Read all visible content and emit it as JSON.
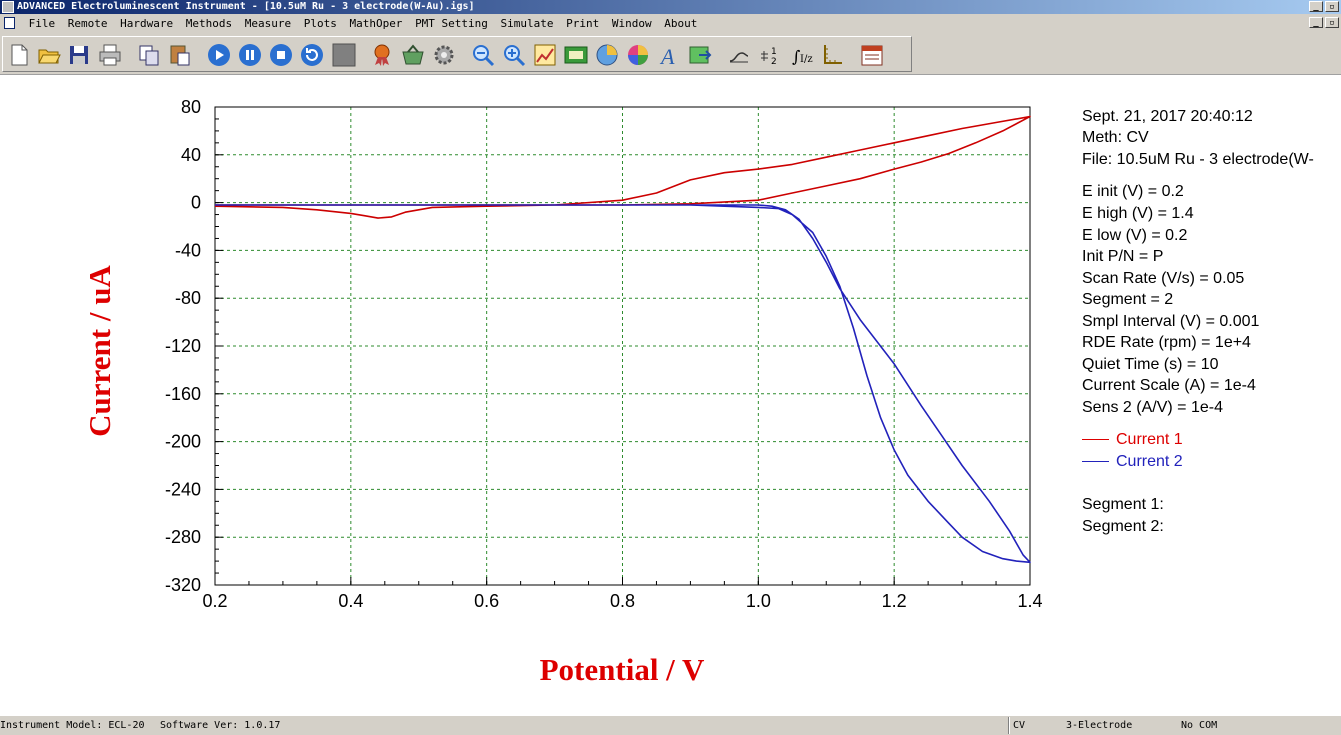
{
  "window": {
    "title": "ADVANCED Electroluminescent Instrument - [10.5uM Ru - 3 electrode(W-Au).igs]",
    "buttons": [
      "_",
      "8"
    ]
  },
  "menubar": {
    "items": [
      "File",
      "Remote",
      "Hardware",
      "Methods",
      "Measure",
      "Plots",
      "MathOper",
      "PMT Setting",
      "Simulate",
      "Print",
      "Window",
      "About"
    ]
  },
  "toolbar": {
    "buttons": [
      "new-file",
      "open-folder",
      "save",
      "print",
      "copy",
      "paste-doc",
      "run",
      "pause",
      "stop",
      "refresh",
      "grey-square",
      "award",
      "basket",
      "gear",
      "zoom-out",
      "zoom-in",
      "chart-edit",
      "image",
      "pie-chart",
      "color-wheel",
      "font-a",
      "export",
      "curve",
      "digits",
      "integral",
      "axis",
      "calendar"
    ]
  },
  "info": {
    "datetime": "Sept. 21, 2017   20:40:12",
    "method": "Meth: CV",
    "file": "File: 10.5uM Ru - 3 electrode(W-",
    "params": [
      "E init (V) = 0.2",
      "E high (V) = 1.4",
      "E low (V) = 0.2",
      "Init P/N = P",
      "Scan Rate (V/s) = 0.05",
      "Segment = 2",
      "Smpl Interval (V) = 0.001",
      "RDE Rate (rpm) = 1e+4",
      "Quiet Time (s) = 10",
      "Current Scale (A) = 1e-4",
      "Sens 2 (A/V) = 1e-4"
    ],
    "segments": [
      "Segment 1:",
      "Segment 2:"
    ]
  },
  "legend": {
    "current1": "Current 1",
    "current2": "Current 2"
  },
  "statusbar": {
    "model": "Instrument Model: ECL-20",
    "software": "Software Ver: 1.0.17",
    "method": "CV",
    "electrode": "3-Electrode",
    "com": "No COM"
  },
  "chart_data": {
    "type": "line",
    "xlabel": "Potential / V",
    "ylabel": "Current / uA",
    "xlim": [
      0.2,
      1.4
    ],
    "ylim": [
      -320,
      80
    ],
    "xticks": [
      "0.2",
      "0.4",
      "0.6",
      "0.8",
      "1.0",
      "1.2",
      "1.4"
    ],
    "yticks": [
      "80",
      "40",
      "0",
      "-40",
      "-80",
      "-120",
      "-160",
      "-200",
      "-240",
      "-280",
      "-320"
    ],
    "grid": true,
    "series": [
      {
        "name": "Current 1",
        "color": "#cc0000",
        "x": [
          0.2,
          0.3,
          0.35,
          0.4,
          0.42,
          0.44,
          0.46,
          0.48,
          0.52,
          0.6,
          0.7,
          0.8,
          0.85,
          0.9,
          0.95,
          1.0,
          1.05,
          1.1,
          1.15,
          1.2,
          1.25,
          1.3,
          1.35,
          1.4,
          1.36,
          1.32,
          1.28,
          1.24,
          1.2,
          1.15,
          1.1,
          1.05,
          1.0,
          0.9,
          0.8,
          0.6,
          0.4,
          0.2
        ],
        "y": [
          -3,
          -4,
          -6,
          -9,
          -11,
          -13,
          -12,
          -8,
          -4,
          -3,
          -2,
          2,
          8,
          19,
          25,
          28,
          32,
          38,
          44,
          50,
          56,
          62,
          67,
          72,
          60,
          50,
          41,
          34,
          28,
          20,
          14,
          8,
          2,
          -1,
          -2,
          -2,
          -2,
          -2
        ]
      },
      {
        "name": "Current 2",
        "color": "#2222bb",
        "x": [
          0.2,
          0.4,
          0.6,
          0.8,
          0.9,
          0.95,
          1.0,
          1.03,
          1.05,
          1.08,
          1.1,
          1.12,
          1.14,
          1.16,
          1.18,
          1.2,
          1.22,
          1.25,
          1.28,
          1.3,
          1.33,
          1.36,
          1.38,
          1.4,
          1.39,
          1.37,
          1.34,
          1.3,
          1.27,
          1.24,
          1.2,
          1.15,
          1.12,
          1.1,
          1.08,
          1.06,
          1.04,
          1.02,
          1.0,
          0.9,
          0.8,
          0.6,
          0.4,
          0.2
        ],
        "y": [
          -2,
          -2,
          -2,
          -2,
          -2,
          -3,
          -4,
          -5,
          -10,
          -25,
          -45,
          -70,
          -105,
          -145,
          -180,
          -207,
          -228,
          -250,
          -268,
          -280,
          -292,
          -298,
          -300,
          -301,
          -295,
          -275,
          -250,
          -220,
          -195,
          -170,
          -135,
          -98,
          -72,
          -50,
          -30,
          -14,
          -6,
          -3,
          -2,
          -2,
          -2,
          -2,
          -2,
          -2
        ]
      }
    ]
  }
}
